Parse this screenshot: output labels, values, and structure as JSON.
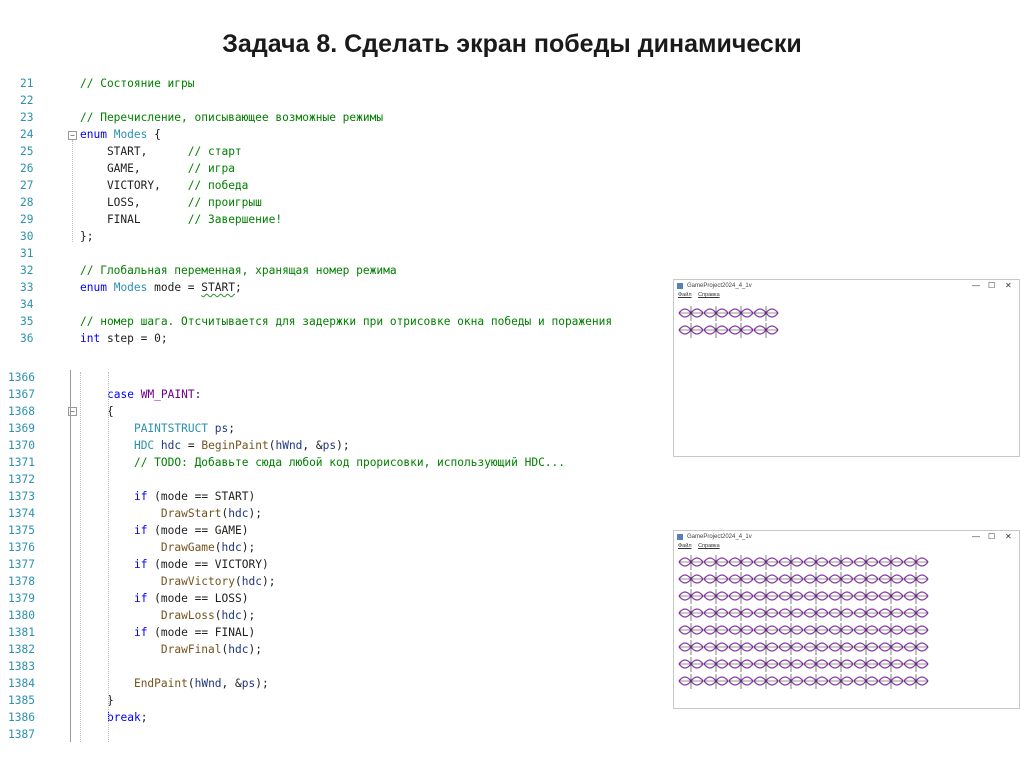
{
  "slide": {
    "title": "Задача 8. Сделать экран победы динамически"
  },
  "code_top": [
    {
      "n": "21",
      "html": "<span class='c'>// Состояние игры</span>"
    },
    {
      "n": "22",
      "html": ""
    },
    {
      "n": "23",
      "html": "<span class='c'>// Перечисление, описывающее возможные режимы</span>"
    },
    {
      "n": "24",
      "html": "<span class='k'>enum</span> <span class='t'>Modes</span> {"
    },
    {
      "n": "25",
      "html": "    START,      <span class='c'>// старт</span>"
    },
    {
      "n": "26",
      "html": "    GAME,       <span class='c'>// игра</span>"
    },
    {
      "n": "27",
      "html": "    VICTORY,    <span class='c'>// победа</span>"
    },
    {
      "n": "28",
      "html": "    LOSS,       <span class='c'>// проигрыш</span>"
    },
    {
      "n": "29",
      "html": "    FINAL       <span class='c'>// Завершение!</span>"
    },
    {
      "n": "30",
      "html": "};"
    },
    {
      "n": "31",
      "html": ""
    },
    {
      "n": "32",
      "html": "<span class='c'>// Глобальная переменная, хранящая номер режима</span>"
    },
    {
      "n": "33",
      "html": "<span class='k'>enum</span> <span class='t'>Modes</span> mode = <span class='squig'>START</span>;"
    },
    {
      "n": "34",
      "html": ""
    },
    {
      "n": "35",
      "html": "<span class='c'>// номер шага. Отсчитывается для задержки при отрисовке окна победы и поражения</span>"
    },
    {
      "n": "36",
      "html": "<span class='k'>int</span> step = 0;"
    }
  ],
  "code_bottom": [
    {
      "n": "1366",
      "html": ""
    },
    {
      "n": "1367",
      "html": "<span class='k'>case</span> <span class='m'>WM_PAINT</span>:"
    },
    {
      "n": "1368",
      "html": "{"
    },
    {
      "n": "1369",
      "html": "    <span class='t'>PAINTSTRUCT</span> <span class='v'>ps</span>;"
    },
    {
      "n": "1370",
      "html": "    <span class='t'>HDC</span> <span class='v'>hdc</span> = <span class='fn'>BeginPaint</span>(<span class='v'>hWnd</span>, &amp;<span class='v'>ps</span>);"
    },
    {
      "n": "1371",
      "html": "    <span class='c'>// TODO: Добавьте сюда любой код прорисовки, использующий HDC...</span>"
    },
    {
      "n": "1372",
      "html": ""
    },
    {
      "n": "1373",
      "html": "    <span class='k'>if</span> (mode == START)"
    },
    {
      "n": "1374",
      "html": "        <span class='fn'>DrawStart</span>(<span class='v'>hdc</span>);"
    },
    {
      "n": "1375",
      "html": "    <span class='k'>if</span> (mode == GAME)"
    },
    {
      "n": "1376",
      "html": "        <span class='fn'>DrawGame</span>(<span class='v'>hdc</span>);"
    },
    {
      "n": "1377",
      "html": "    <span class='k'>if</span> (mode == VICTORY)"
    },
    {
      "n": "1378",
      "html": "        <span class='fn'>DrawVictory</span>(<span class='v'>hdc</span>);"
    },
    {
      "n": "1379",
      "html": "    <span class='k'>if</span> (mode == LOSS)"
    },
    {
      "n": "1380",
      "html": "        <span class='fn'>DrawLoss</span>(<span class='v'>hdc</span>);"
    },
    {
      "n": "1381",
      "html": "    <span class='k'>if</span> (mode == FINAL)"
    },
    {
      "n": "1382",
      "html": "        <span class='fn'>DrawFinal</span>(<span class='v'>hdc</span>);"
    },
    {
      "n": "1383",
      "html": ""
    },
    {
      "n": "1384",
      "html": "    <span class='fn'>EndPaint</span>(<span class='v'>hWnd</span>, &amp;<span class='v'>ps</span>);"
    },
    {
      "n": "1385",
      "html": "}"
    },
    {
      "n": "1386",
      "html": "<span class='k'>break</span>;"
    },
    {
      "n": "1387",
      "html": ""
    }
  ],
  "window_small": {
    "title": "GameProject2024_4_1v",
    "menu": [
      "Файл",
      "Справка"
    ],
    "controls": [
      "—",
      "☐",
      "✕"
    ],
    "pattern_rows": 2,
    "pattern_cols": 4
  },
  "window_large": {
    "title": "GameProject2024_4_1v",
    "menu": [
      "Файл",
      "Справка"
    ],
    "controls": [
      "—",
      "☐",
      "✕"
    ],
    "pattern_rows": 8,
    "pattern_cols": 10
  },
  "colors": {
    "comment": "#008000",
    "keyword": "#0000ff",
    "type": "#2b91af",
    "pattern": "#8a3aa8",
    "pattern_cross": "#2c2c2c"
  }
}
